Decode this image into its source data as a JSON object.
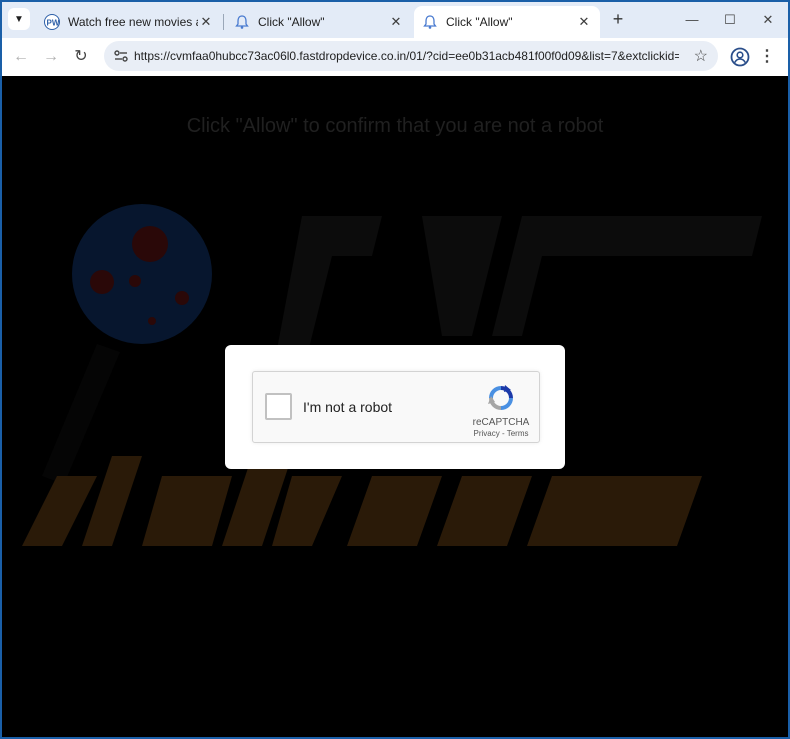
{
  "browser": {
    "tabs": [
      {
        "title": "Watch free new movies and TV",
        "favicon": "pw-logo-icon",
        "active": false
      },
      {
        "title": "Click \"Allow\"",
        "favicon": "bell-icon",
        "active": false
      },
      {
        "title": "Click \"Allow\"",
        "favicon": "bell-icon",
        "active": true
      }
    ],
    "url": "https://cvmfaa0hubcc73ac06l0.fastdropdevice.co.in/01/?cid=ee0b31acb481f00f0d09&list=7&extclickid=...",
    "icons": {
      "tab_search": "chevron-down-icon",
      "new_tab": "plus-icon",
      "minimize": "minimize-icon",
      "maximize": "maximize-icon",
      "close": "close-icon",
      "back": "back-arrow-icon",
      "forward": "forward-arrow-icon",
      "reload": "reload-icon",
      "site_info": "site-settings-icon",
      "bookmark": "star-icon",
      "profile": "profile-icon",
      "menu": "kebab-menu-icon"
    }
  },
  "page": {
    "headline": "Click \"Allow\" to confirm that you are not a robot",
    "captcha": {
      "checkbox_label": "I'm not a robot",
      "brand": "reCAPTCHA",
      "privacy_link": "Privacy",
      "separator": " - ",
      "terms_link": "Terms"
    }
  },
  "colors": {
    "window_frame": "#1a5fa8",
    "tabstrip_bg": "#e3ebf7",
    "page_bg": "#000000",
    "headline_text": "#202020",
    "watermark_orange": "#2a1a08"
  }
}
